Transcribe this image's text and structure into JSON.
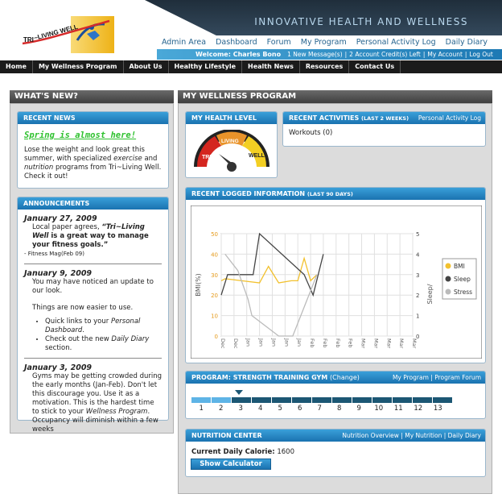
{
  "header": {
    "tagline": "INNOVATIVE HEALTH AND WELLNESS",
    "logo_text": "TRI~LIVING WELL",
    "top_links": [
      "Admin Area",
      "Dashboard",
      "Forum",
      "My Program",
      "Personal Activity Log",
      "Daily Diary"
    ],
    "welcome": "Welcome: Charles Bono",
    "account_links": [
      "1 New Message(s)",
      "2 Account Credit(s) Left",
      "My Account",
      "Log Out"
    ]
  },
  "nav": [
    "Home",
    "My Wellness Program",
    "About Us",
    "Healthy Lifestyle",
    "Health News",
    "Resources",
    "Contact Us"
  ],
  "left_col": {
    "title": "WHAT'S NEW?",
    "recent_news": {
      "title": "RECENT NEWS",
      "headline": "Spring is almost here!",
      "text_1": "Lose the weight and look great this summer, with specialized ",
      "text_em1": "exercise",
      "text_2": " and ",
      "text_em2": "nutrition",
      "text_3": " programs from Tri~Living Well. Check it out!"
    },
    "announcements": {
      "title": "ANNOUNCEMENTS",
      "a1_date": "January 27, 2009",
      "a1_text": "Local paper agrees, ",
      "a1_quote_open": "“",
      "a1_quote_brand": "Tri~Living Well",
      "a1_quote": " is a great way to manage your fitness goals.",
      "a1_quote_close": "”",
      "a1_source": "- Fitness Mag(Feb 09)",
      "a2_date": "January 9, 2009",
      "a2_text": "You may have noticed an update to our look.",
      "a2_text2": "Things are now easier to use.",
      "a2_b1": "Quick links to your ",
      "a2_b1_em": "Personal Dashboard",
      "a2_b1_end": ".",
      "a2_b2": "Check out the new ",
      "a2_b2_em": "Daily Diary",
      "a2_b2_end": " section.",
      "a3_date": "January 3, 2009",
      "a3_text": "Gyms may be getting crowded during the early months (Jan-Feb). Don't let this discourage you. Use it as a motivation. This is the hardest time to stick to your ",
      "a3_em": "Wellness Program",
      "a3_text2": ". Occupancy will diminish within a few weeks"
    }
  },
  "right_col": {
    "title": "MY WELLNESS PROGRAM",
    "health_level": {
      "title": "MY HEALTH LEVEL",
      "gauge": [
        "TRI",
        "LIVING",
        "WELL"
      ]
    },
    "recent_activities": {
      "title": "RECENT ACTIVITIES",
      "sub": "(LAST 2 WEEKS)",
      "link": "Personal Activity Log",
      "item": "Workouts (0)"
    },
    "logged": {
      "title": "RECENT LOGGED INFORMATION",
      "sub": "(LAST 90 DAYS)"
    },
    "program": {
      "title": "PROGRAM: STRENGTH TRAINING GYM",
      "change": "(Change)",
      "links": [
        "My Program",
        "Program Forum"
      ],
      "steps": [
        "1",
        "2",
        "3",
        "4",
        "5",
        "6",
        "7",
        "8",
        "9",
        "10",
        "11",
        "12",
        "13"
      ],
      "completed_steps": 2,
      "current_step": 3
    },
    "nutrition": {
      "title": "NUTRITION CENTER",
      "links": [
        "Nutrition Overview",
        "My Nutrition",
        "Daily Diary"
      ],
      "calorie_label": "Current Daily Calorie:",
      "calorie_value": "1600",
      "button": "Show Calculator"
    }
  },
  "chart_data": {
    "type": "line",
    "ylabel": "BMI(%)",
    "y2label": "Sleep/",
    "ylim": [
      0,
      50
    ],
    "y2lim": [
      0,
      5
    ],
    "yticks": [
      "0",
      "10",
      "20",
      "30",
      "40",
      "50"
    ],
    "y2ticks": [
      "0",
      "1",
      "2",
      "3",
      "4",
      "5"
    ],
    "xticks": [
      "Dec",
      "Dec",
      "Jan",
      "Jan",
      "Jan",
      "Jan",
      "Jan",
      "Feb",
      "Feb",
      "Feb",
      "Feb",
      "Mar",
      "Mar",
      "Mar",
      "Mar",
      "Mar"
    ],
    "grid": true,
    "legend_position": "right",
    "series": [
      {
        "name": "BMI",
        "color": "#f2c12e",
        "axis": "left",
        "x": [
          0,
          0.3,
          3.0,
          3.7,
          4.5,
          5.5,
          6.0,
          6.5,
          7.0,
          7.5
        ],
        "values": [
          27,
          28,
          26,
          34,
          26,
          27,
          27,
          38,
          27,
          30
        ]
      },
      {
        "name": "Sleep",
        "color": "#444444",
        "axis": "right",
        "x": [
          0,
          0.5,
          2.5,
          3.0,
          6.5,
          7.2,
          8.0
        ],
        "values": [
          2.0,
          3.0,
          3.0,
          5.0,
          3.0,
          2.0,
          4.0
        ]
      },
      {
        "name": "Stress",
        "color": "#bbbbbb",
        "axis": "right",
        "x": [
          0.3,
          1.3,
          2.1,
          2.4,
          4.5,
          5.6,
          7.5
        ],
        "values": [
          4.0,
          3.2,
          1.8,
          1.0,
          0.0,
          0.0,
          3.0
        ]
      }
    ]
  }
}
